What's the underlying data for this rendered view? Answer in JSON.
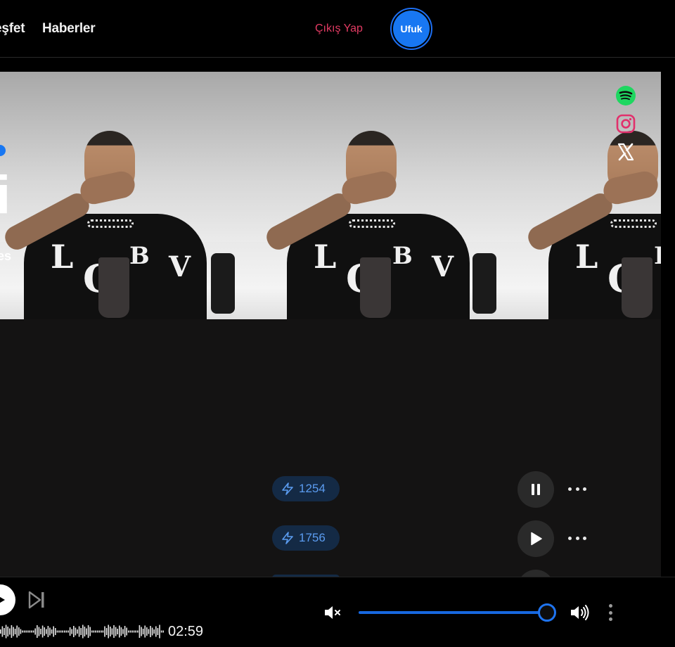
{
  "nav": {
    "links": [
      "eşfet",
      "Haberler"
    ],
    "logout_label": "Çıkış Yap",
    "avatar_label": "Ufuk"
  },
  "hero": {
    "title_fragment": "i",
    "subtitle_fragment": "es",
    "social_icons": [
      "spotify-icon",
      "instagram-icon",
      "x-icon"
    ]
  },
  "tracks": [
    {
      "plays": "1254",
      "state": "playing"
    },
    {
      "plays": "1756",
      "state": "paused"
    }
  ],
  "player": {
    "duration": "02:59",
    "volume_percent": 100
  },
  "colors": {
    "accent": "#1877f2",
    "logout": "#e23b63",
    "badge_bg": "#142a45",
    "badge_text": "#5b9cf0",
    "spotify": "#1ed760",
    "instagram": "#e1306c"
  }
}
